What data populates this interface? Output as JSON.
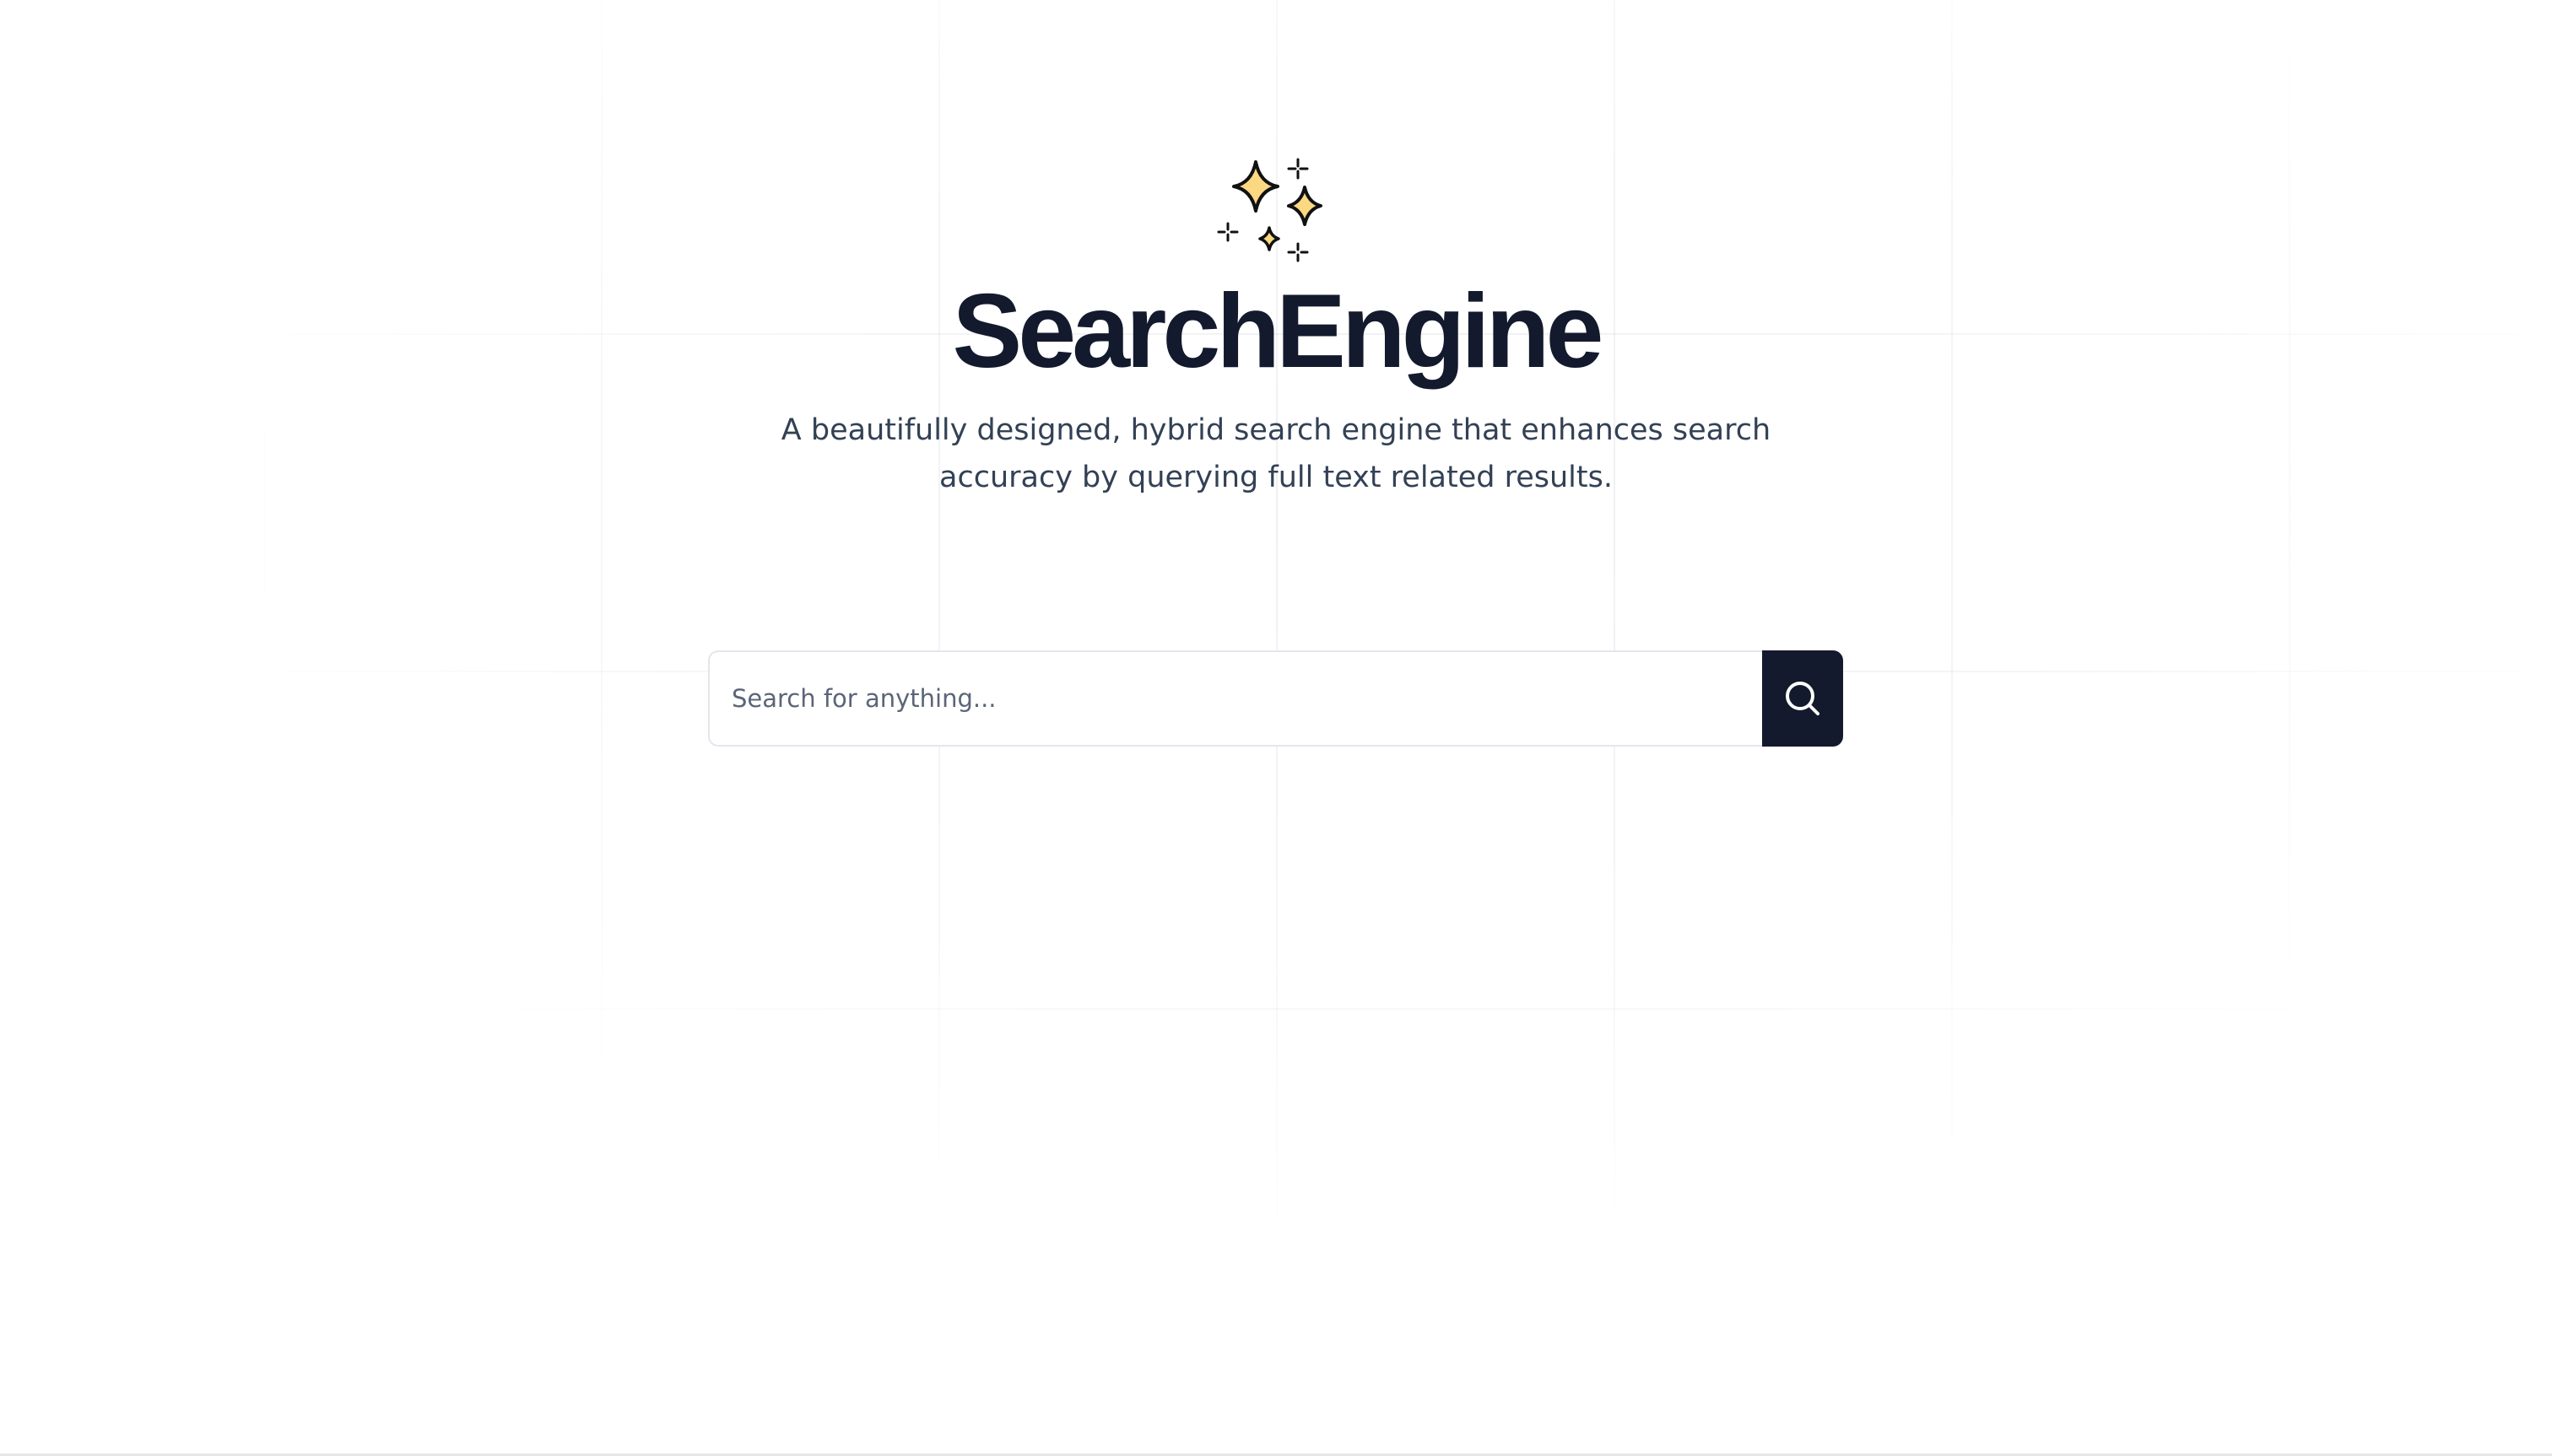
{
  "hero": {
    "icon": "sparkles-icon",
    "title": "SearchEngine",
    "subtitle": "A beautifully designed, hybrid search engine that enhances search accuracy by querying full text related results."
  },
  "search": {
    "value": "",
    "placeholder": "Search for anything...",
    "button_icon": "search-icon"
  },
  "colors": {
    "title": "#131a2e",
    "subtitle": "#334155",
    "button_bg": "#131a2e",
    "sparkle_fill": "#fcd883",
    "grid_line": "#eef0f3"
  }
}
